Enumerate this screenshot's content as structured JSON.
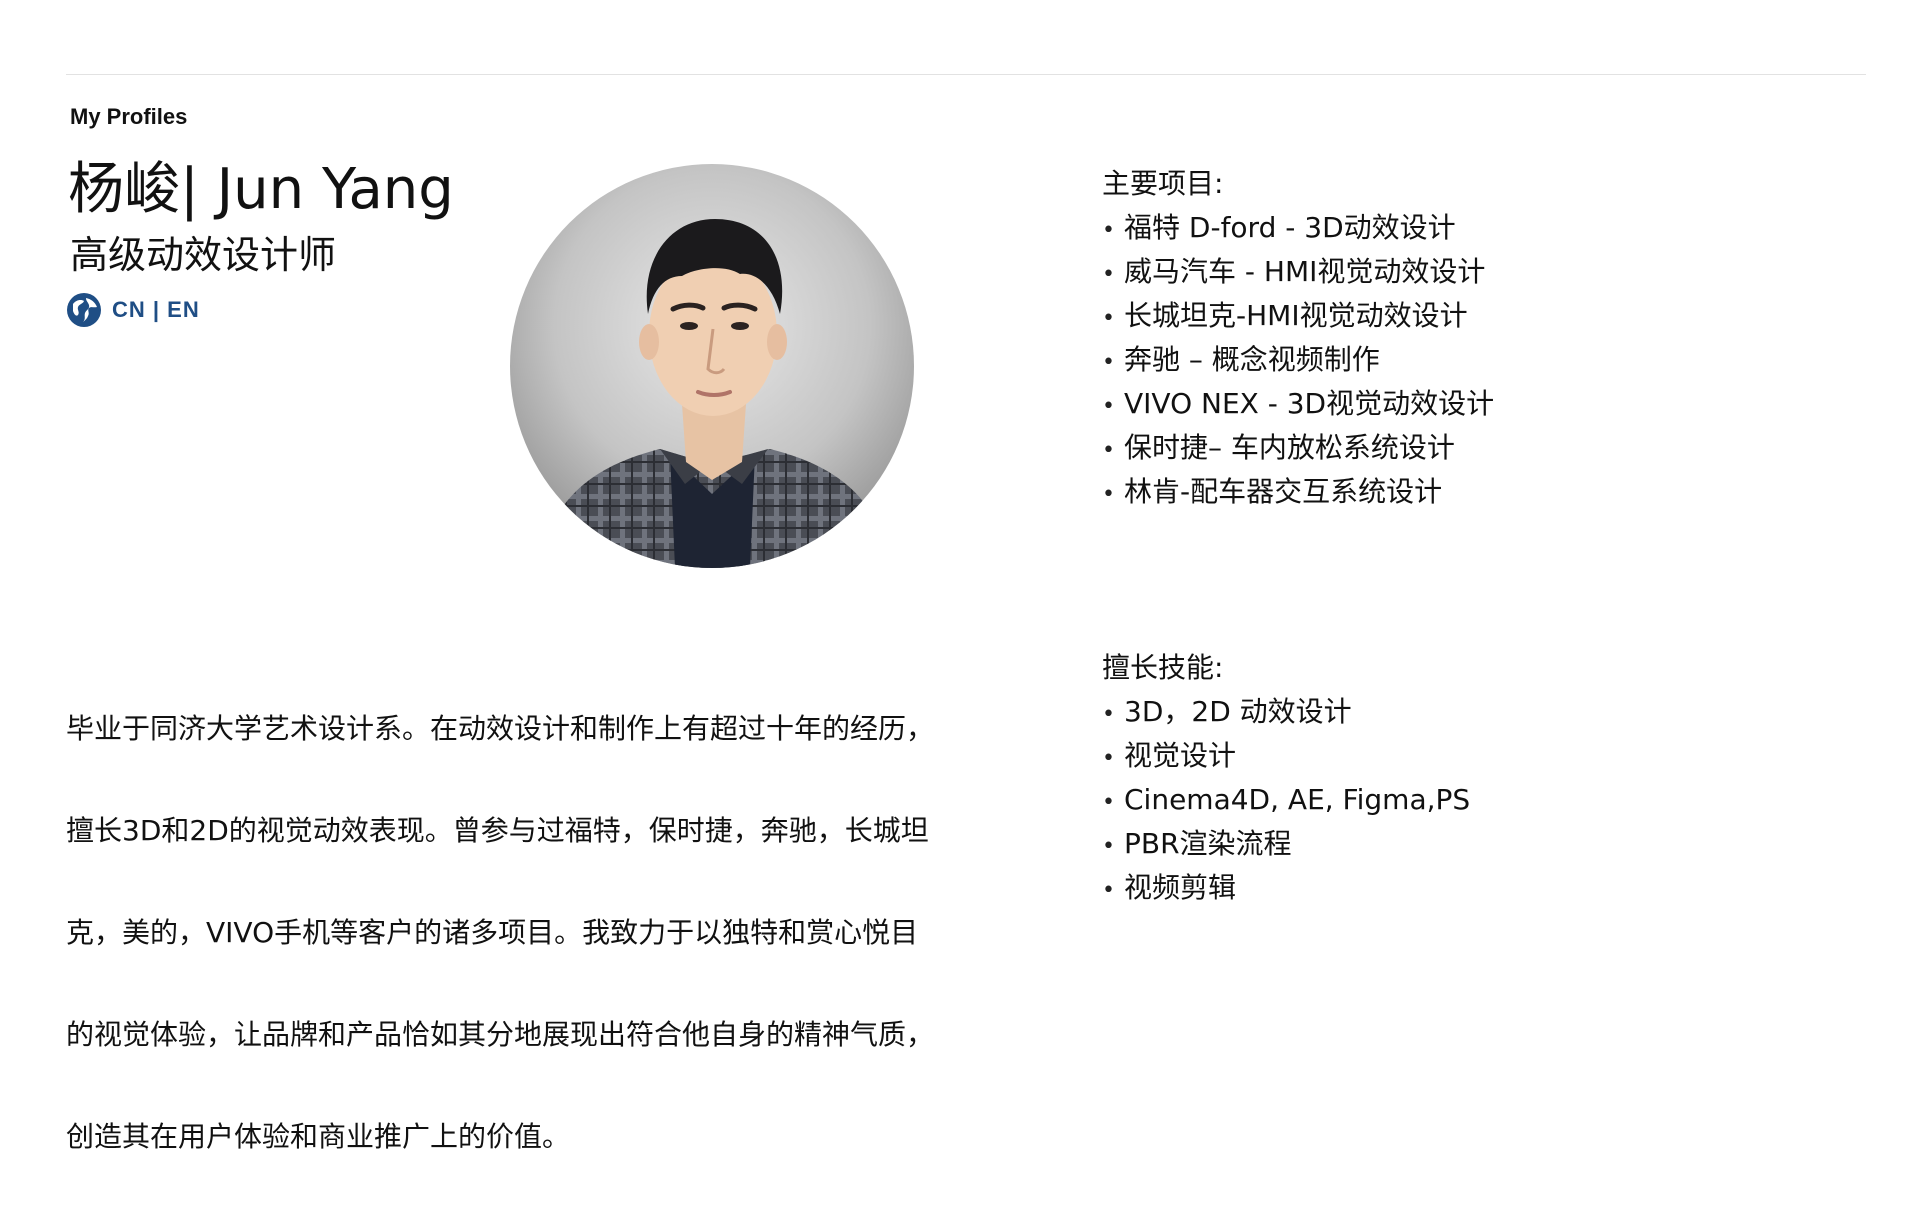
{
  "page": {
    "section_label": "My Profiles"
  },
  "profile": {
    "name": "杨峻| Jun Yang",
    "role": "高级动效设计师",
    "language_switch": "CN | EN",
    "portrait_alt": "portrait photo"
  },
  "projects": {
    "heading": "主要项目:",
    "items": [
      "福特 D-ford - 3D动效设计",
      "威马汽车 - HMI视觉动效设计",
      "长城坦克-HMI视觉动效设计",
      "奔驰 – 概念视频制作",
      "VIVO NEX - 3D视觉动效设计",
      "保时捷– 车内放松系统设计",
      "林肯-配车器交互系统设计"
    ]
  },
  "bio": {
    "lines": [
      "毕业于同济大学艺术设计系。在动效设计和制作上有超过十年的经历，",
      "擅长3D和2D的视觉动效表现。曾参与过福特，保时捷，奔驰，长城坦",
      "克，美的，VIVO手机等客户的诸多项目。我致力于以独特和赏心悦目",
      "的视觉体验，让品牌和产品恰如其分地展现出符合他自身的精神气质，",
      "创造其在用户体验和商业推广上的价值。"
    ]
  },
  "skills": {
    "heading": "擅长技能:",
    "items": [
      "3D，2D 动效设计",
      "视觉设计",
      "Cinema4D, AE, Figma,PS",
      "PBR渲染流程",
      "视频剪辑"
    ]
  },
  "colors": {
    "accent": "#1f4e85",
    "text": "#111111",
    "rule": "#e2e2e2"
  },
  "icons": {
    "language": "globe-icon",
    "bullet": "bullet-dot"
  }
}
